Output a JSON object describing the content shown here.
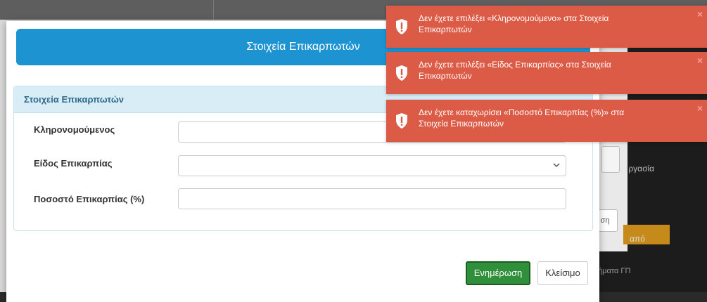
{
  "background": {
    "right_text_1": "Ιργασία",
    "right_text_2": "από",
    "right_text_3": "ήματα ΓΠ",
    "right_button": "ση"
  },
  "modal": {
    "title": "Στοιχεία Επικαρπωτών",
    "section_title": "Στοιχεία Επικαρπωτών",
    "fields": [
      {
        "label": "Κληρονομούμενος",
        "value": ""
      },
      {
        "label": "Είδος Επικαρπίας",
        "value": ""
      },
      {
        "label": "Ποσοστό Επικαρπίας (%)",
        "value": ""
      }
    ],
    "update_button": "Ενημέρωση",
    "close_button": "Κλείσιμο"
  },
  "toasts": [
    {
      "message": "Δεν έχετε επιλέξει «Κληρονομούμενο» στα Στοιχεία Επικαρπωτών",
      "close": "×"
    },
    {
      "message": "Δεν έχετε επιλέξει «Είδος Επικαρπίας» στα Στοιχεία Επικαρπωτών",
      "close": "×"
    },
    {
      "message": "Δεν έχετε καταχωρίσει «Ποσοστό Επικαρπίας (%)» στα Στοιχεία Επικαρπωτών",
      "close": "×"
    }
  ],
  "colors": {
    "modal_header": "#1e93d2",
    "toast_error": "#dc5b47",
    "update_button": "#2f8f3a"
  }
}
